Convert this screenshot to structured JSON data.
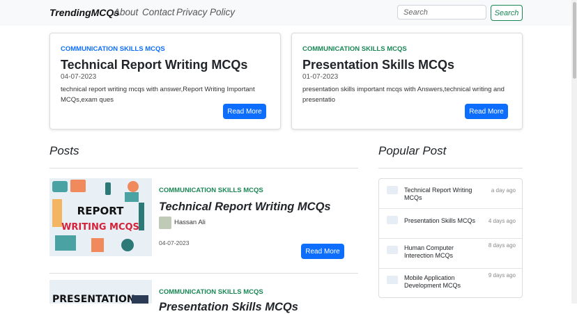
{
  "navbar": {
    "brand": "TrendingMCQs",
    "links": [
      "About",
      "Contact",
      "Privacy Policy"
    ],
    "search_placeholder": "Search",
    "search_button": "Search"
  },
  "featured": [
    {
      "category": "COMMUNICATION SKILLS MCQS",
      "title": "Technical Report Writing MCQs",
      "date": "04-07-2023",
      "description": "technical report writing mcqs with answer,Report Writing Important MCQs,exam ques",
      "button": "Read More",
      "category_color": "#0d6efd"
    },
    {
      "category": "COMMUNICATION SKILLS MCQS",
      "title": "Presentation Skills MCQs",
      "date": "01-07-2023",
      "description": "presentation skills important mcqs with Answers,technical writing and presentatio",
      "button": "Read More",
      "category_color": "#198754"
    }
  ],
  "posts_section": {
    "title": "Posts",
    "items": [
      {
        "category": "COMMUNICATION SKILLS MCQS",
        "title": "Technical Report Writing MCQs",
        "author": "Hassan Ali",
        "date": "04-07-2023",
        "button": "Read More",
        "thumb_text_1": "REPORT",
        "thumb_text_2": "WRITING MCQS"
      },
      {
        "category": "COMMUNICATION SKILLS MCQS",
        "title": "Presentation Skills MCQs",
        "thumb_text_1": "PRESENTATION"
      }
    ]
  },
  "popular": {
    "title": "Popular Post",
    "items": [
      {
        "title": "Technical Report Writing MCQs",
        "time": "a day ago"
      },
      {
        "title": "Presentation Skills MCQs",
        "time": "4 days ago"
      },
      {
        "title": "Human Computer Interection MCQs",
        "time": "8 days ago"
      },
      {
        "title": "Mobile Application Development MCQs",
        "time": "9 days ago"
      }
    ]
  },
  "colors": {
    "primary": "#0d6efd",
    "success": "#198754"
  }
}
